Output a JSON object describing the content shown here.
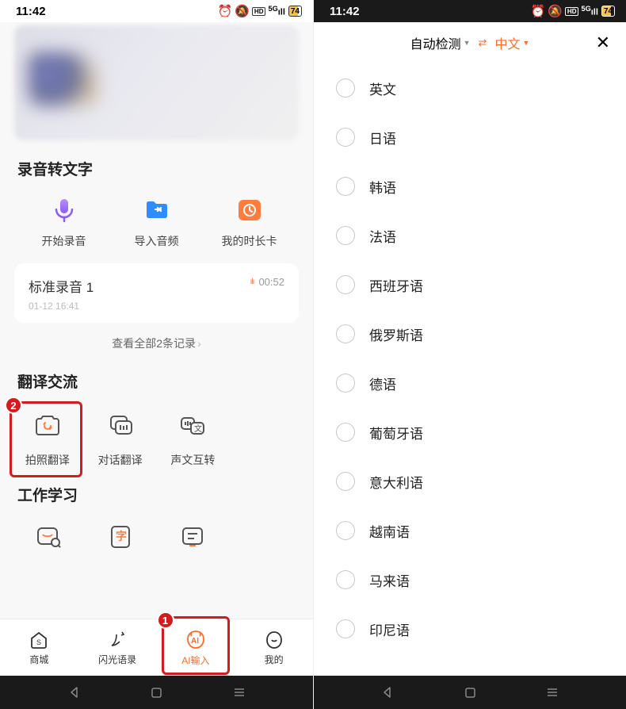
{
  "status": {
    "time": "11:42",
    "battery": "74",
    "hd": "HD",
    "net": "5G"
  },
  "left": {
    "sec_record": {
      "title": "录音转文字",
      "items": [
        {
          "label": "开始录音"
        },
        {
          "label": "导入音频"
        },
        {
          "label": "我的时长卡"
        }
      ]
    },
    "record_card": {
      "title": "标准录音 1",
      "duration": "00:52",
      "time": "01-12 16:41"
    },
    "viewall": "查看全部2条记录",
    "sec_translate": {
      "title": "翻译交流",
      "items": [
        {
          "label": "拍照翻译"
        },
        {
          "label": "对话翻译"
        },
        {
          "label": "声文互转"
        }
      ]
    },
    "sec_work": {
      "title": "工作学习"
    },
    "nav": [
      {
        "label": "商城"
      },
      {
        "label": "闪光语录"
      },
      {
        "label": "AI输入"
      },
      {
        "label": "我的"
      }
    ]
  },
  "right": {
    "src_label": "自动检测",
    "tgt_label": "中文",
    "languages": [
      "英文",
      "日语",
      "韩语",
      "法语",
      "西班牙语",
      "俄罗斯语",
      "德语",
      "葡萄牙语",
      "意大利语",
      "越南语",
      "马来语",
      "印尼语"
    ]
  }
}
